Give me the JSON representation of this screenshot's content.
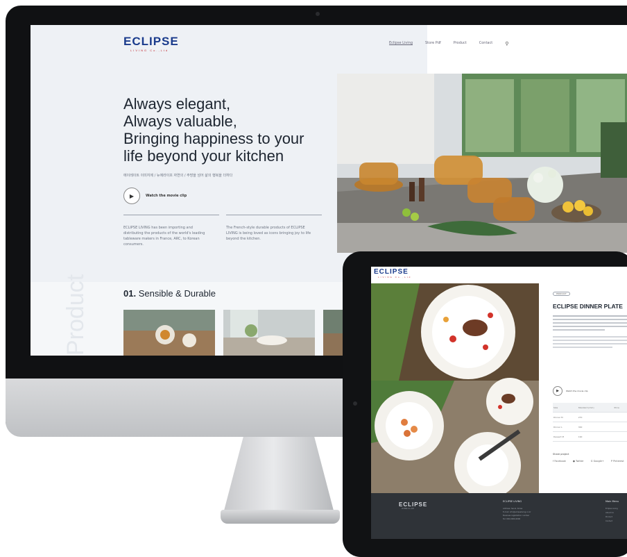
{
  "brand": {
    "name": "ECLIPSE",
    "sub": "LIVING Co.,Ltd",
    "color": "#1a3b8c",
    "accent": "#c0262d"
  },
  "desktop": {
    "nav": [
      "Eclipse Living",
      "Store Pdf",
      "Product",
      "Contact"
    ],
    "search_icon": "search-icon",
    "headline": [
      "Always elegant,",
      "Always valuable,",
      "Bringing happiness to your",
      "life beyond your kitchen"
    ],
    "korean_tagline": "에이레이트 이미지에 / 뉴에라이프 자연의 / 주방을 넘어 삶의 행복을 더하다",
    "watch_label": "Watch the movie clip",
    "intro_left": "ECLIPSE LIVING has been importing and distributing the products of the world's leading tableware makers in France, ARC, to Korean consumers.",
    "intro_right": "The French-style durable products of ECLIPSE LIVING is being loved as icons bringing joy to life beyond the kitchen.",
    "section_number": "01.",
    "section_title": "Sensible & Durable",
    "vertical_word": "Product"
  },
  "tablet": {
    "badge": "PRODUCT",
    "product_title": "ECLIPSE DINNER PLATE",
    "watch_label": "Watch the movie clip",
    "table": {
      "headers": [
        "Size",
        "Standard (mm)",
        "Price"
      ],
      "rows": [
        [
          "Dinner M",
          "270",
          ""
        ],
        [
          "Dinner L",
          "300",
          ""
        ],
        [
          "Dessert M",
          "190",
          ""
        ]
      ]
    },
    "share_label": "Share project",
    "social": [
      "Facebook",
      "Twitter",
      "Google+",
      "Pinterest"
    ],
    "footer": {
      "company": "ECLIPSE LIVING",
      "lines": [
        "Address: Seoul, Korea",
        "E-mail: info@eclipseliving.co.kr",
        "Business registration number",
        "Tel: 000-0000-0000"
      ],
      "menu_title": "Main Menu",
      "menu": [
        "Eclipse Living",
        "About Us",
        "Product",
        "Contact"
      ]
    }
  }
}
